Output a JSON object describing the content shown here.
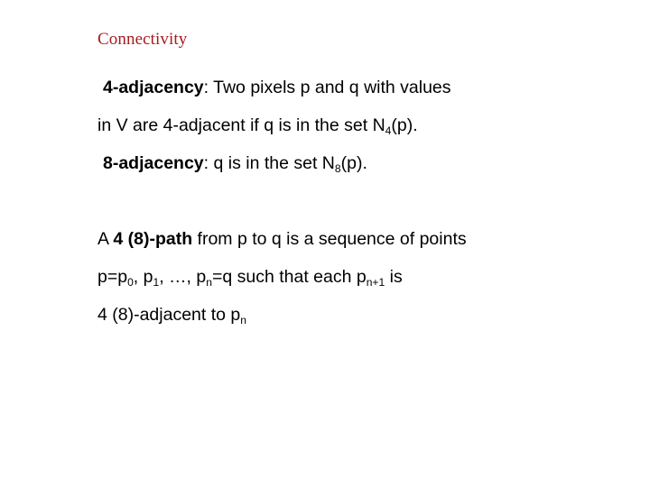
{
  "slide": {
    "title": "Connectivity",
    "title_color": "#a51c20",
    "background_color": "#ffffff",
    "body_color": "#000000",
    "lines": [
      {
        "id": "four-adjacency",
        "indent": true,
        "segments": [
          {
            "text": "4-adjacency",
            "bold": true
          },
          {
            "text": ": Two pixels p and q with values",
            "bold": false
          }
        ]
      },
      {
        "id": "four-adjacency-cont",
        "indent": false,
        "segments": [
          {
            "text": "in V are 4-adjacent if q is in the set N",
            "bold": false
          },
          {
            "text": "4",
            "bold": false,
            "sub": true
          },
          {
            "text": "(p).",
            "bold": false
          }
        ]
      },
      {
        "id": "eight-adjacency",
        "indent": true,
        "segments": [
          {
            "text": "8-adjacency",
            "bold": true
          },
          {
            "text": ": q is in the set N",
            "bold": false
          },
          {
            "text": "8",
            "bold": false,
            "sub": true
          },
          {
            "text": "(p).",
            "bold": false
          }
        ]
      },
      {
        "id": "blank-gap",
        "indent": false,
        "segments": []
      },
      {
        "id": "path-definition",
        "indent": false,
        "segments": [
          {
            "text": "A ",
            "bold": false
          },
          {
            "text": "4 (8)-path",
            "bold": true
          },
          {
            "text": " from p to q is a sequence of points",
            "bold": false
          }
        ]
      },
      {
        "id": "path-sequence",
        "indent": false,
        "segments": [
          {
            "text": "p=p",
            "bold": false
          },
          {
            "text": "0",
            "bold": false,
            "sub": true
          },
          {
            "text": ", p",
            "bold": false
          },
          {
            "text": "1",
            "bold": false,
            "sub": true
          },
          {
            "text": ", …, p",
            "bold": false
          },
          {
            "text": "n",
            "bold": false,
            "sub": true
          },
          {
            "text": "=q such that each p",
            "bold": false
          },
          {
            "text": "n+1",
            "bold": false,
            "sub": true
          },
          {
            "text": " is",
            "bold": false
          }
        ]
      },
      {
        "id": "path-adjacency",
        "indent": false,
        "segments": [
          {
            "text": "4 (8)-adjacent to p",
            "bold": false
          },
          {
            "text": "n",
            "bold": false,
            "sub": true
          }
        ]
      }
    ]
  }
}
